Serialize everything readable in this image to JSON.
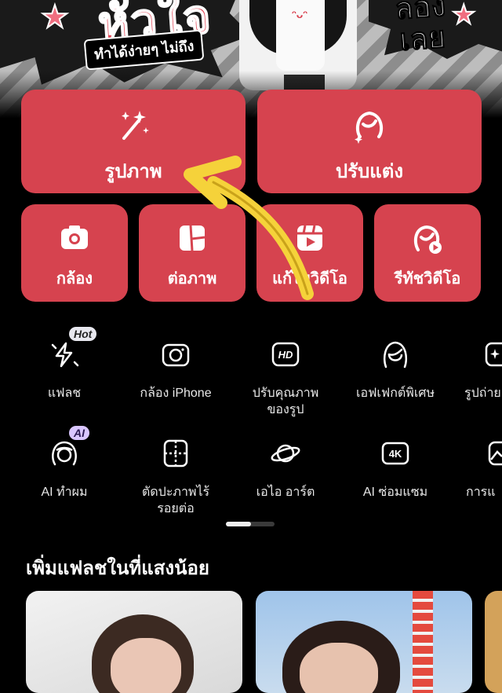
{
  "banner": {
    "title": "หัวใจ",
    "subtitle": "ทำได้ง่ายๆ ไม่ถึง",
    "right_text": "ลองเลย",
    "right_text_line1": "ลอง",
    "right_text_line2": "เลย",
    "shirt_logo": "ᵔᴗᵔ"
  },
  "big_tiles": [
    {
      "label": "รูปภาพ",
      "icon": "magic-wand-icon"
    },
    {
      "label": "ปรับแต่ง",
      "icon": "face-sparkle-icon"
    }
  ],
  "small_tiles": [
    {
      "label": "กล้อง",
      "icon": "camera-icon"
    },
    {
      "label": "ต่อภาพ",
      "icon": "collage-icon"
    },
    {
      "label": "แก้ไขวิดีโอ",
      "icon": "video-edit-icon"
    },
    {
      "label": "รีทัชวิดีโอ",
      "icon": "video-retouch-icon"
    }
  ],
  "tools_row1": [
    {
      "label": "แฟลช",
      "icon": "flash-icon",
      "badge": "Hot"
    },
    {
      "label": "กล้อง iPhone",
      "icon": "camera-outline-icon",
      "badge": ""
    },
    {
      "label": "ปรับคุณภาพ\nของรูป",
      "icon": "hd-icon",
      "badge": ""
    },
    {
      "label": "เอฟเฟกต์พิเศษ",
      "icon": "face-outline-icon",
      "badge": ""
    },
    {
      "label": "รูปถ่าย",
      "icon": "sparkle-frame-icon",
      "badge": ""
    }
  ],
  "tools_row2": [
    {
      "label": "AI ทำผม",
      "icon": "hair-icon",
      "badge": "AI"
    },
    {
      "label": "ตัดปะภาพไร้\nรอยต่อ",
      "icon": "seamless-cut-icon",
      "badge": ""
    },
    {
      "label": "เอไอ อาร์ต",
      "icon": "planet-icon",
      "badge": ""
    },
    {
      "label": "AI ซ่อมแซม",
      "icon": "4k-icon",
      "badge": ""
    },
    {
      "label": "การแ",
      "icon": "landscape-icon",
      "badge": ""
    }
  ],
  "pager": {
    "current_page": 1,
    "total_pages": 2
  },
  "section": {
    "title": "เพิ่มแฟลชในที่แสงน้อย"
  },
  "colors": {
    "accent": "#d6434f",
    "background": "#000000",
    "arrow": "#f5d23a"
  }
}
